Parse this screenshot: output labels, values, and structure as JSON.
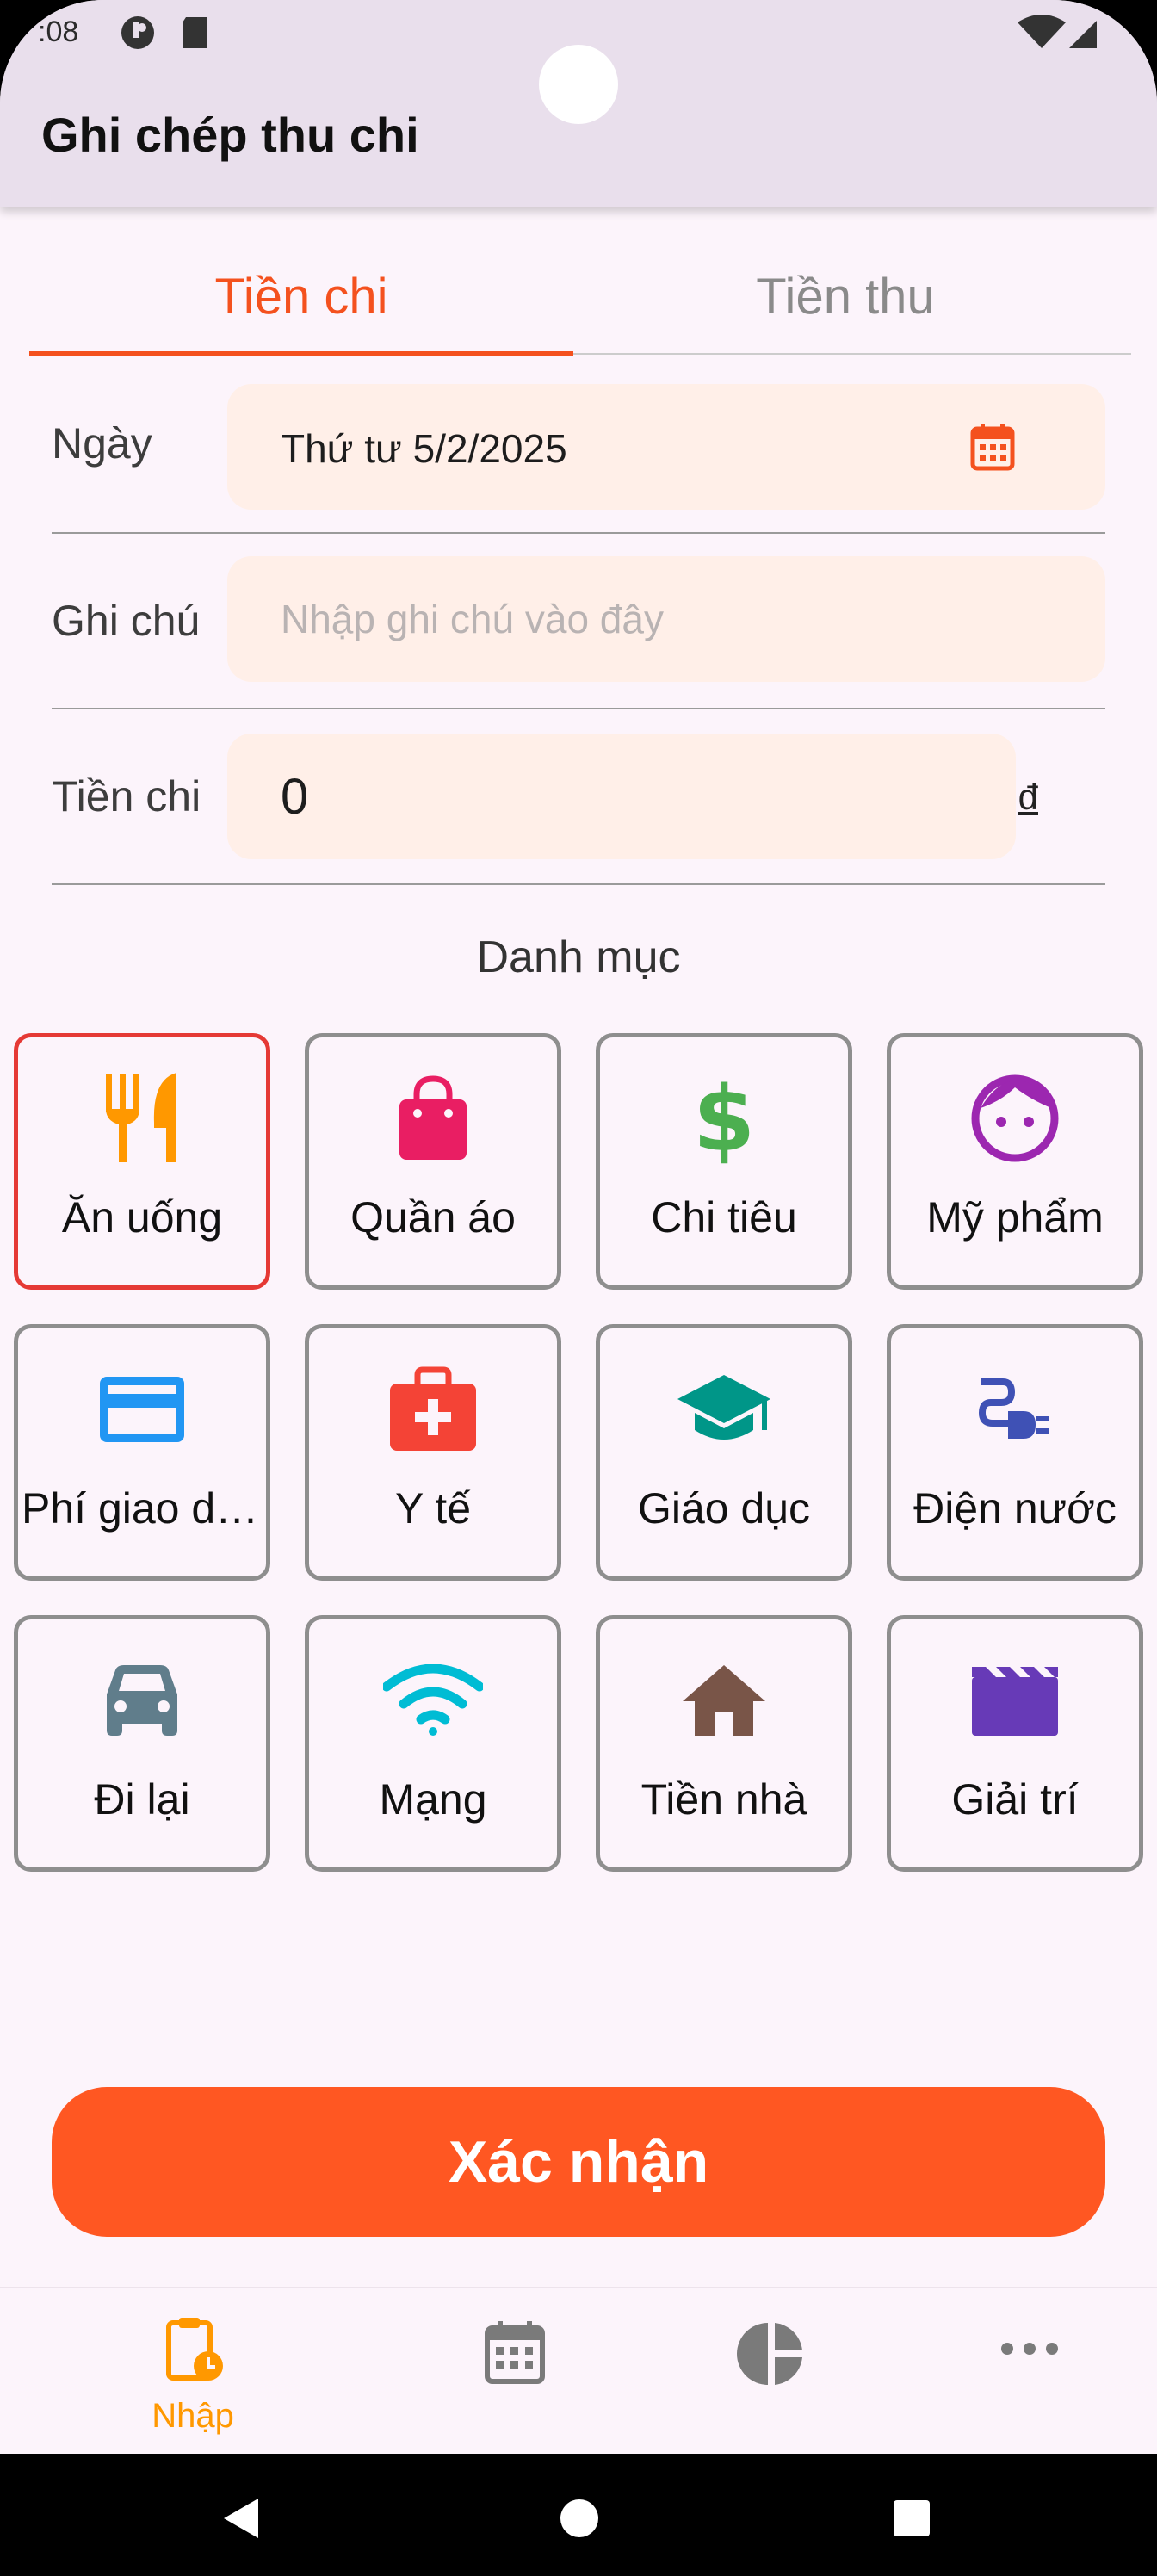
{
  "status_bar": {
    "time": ":08"
  },
  "app_bar": {
    "title": "Ghi chép thu chi"
  },
  "tabs": [
    {
      "label": "Tiền chi",
      "active": true
    },
    {
      "label": "Tiền thu",
      "active": false
    }
  ],
  "form": {
    "date": {
      "label": "Ngày",
      "value": "Thứ tư 5/2/2025"
    },
    "note": {
      "label": "Ghi chú",
      "placeholder": "Nhập ghi chú vào đây"
    },
    "amount": {
      "label": "Tiền chi",
      "value": "0",
      "currency": "đ"
    }
  },
  "categories_title": "Danh mục",
  "categories": [
    {
      "label": "Ăn uống",
      "icon": "restaurant-icon",
      "color": "#FF9800",
      "selected": true
    },
    {
      "label": "Quần áo",
      "icon": "shopping-bag-icon",
      "color": "#E91E63",
      "selected": false
    },
    {
      "label": "Chi tiêu",
      "icon": "dollar-icon",
      "color": "#4CAF50",
      "selected": false
    },
    {
      "label": "Mỹ phẩm",
      "icon": "face-icon",
      "color": "#9C27B0",
      "selected": false
    },
    {
      "label": "Phí giao dịch",
      "icon": "credit-card-icon",
      "color": "#2196F3",
      "selected": false
    },
    {
      "label": "Y tế",
      "icon": "medical-kit-icon",
      "color": "#F44336",
      "selected": false
    },
    {
      "label": "Giáo dục",
      "icon": "graduation-cap-icon",
      "color": "#009688",
      "selected": false
    },
    {
      "label": "Điện nước",
      "icon": "power-plug-icon",
      "color": "#3F51B5",
      "selected": false
    },
    {
      "label": "Đi lại",
      "icon": "car-icon",
      "color": "#607D8B",
      "selected": false
    },
    {
      "label": "Mạng",
      "icon": "wifi-icon",
      "color": "#00BCD4",
      "selected": false
    },
    {
      "label": "Tiền nhà",
      "icon": "home-icon",
      "color": "#795548",
      "selected": false
    },
    {
      "label": "Giải trí",
      "icon": "clapperboard-icon",
      "color": "#673AB7",
      "selected": false
    }
  ],
  "confirm_button": "Xác nhận",
  "bottom_nav": [
    {
      "label": "Nhập",
      "icon": "clipboard-clock-icon",
      "active": true
    },
    {
      "label": "",
      "icon": "calendar-icon",
      "active": false
    },
    {
      "label": "",
      "icon": "pie-chart-icon",
      "active": false
    },
    {
      "label": "",
      "icon": "more-icon",
      "active": false
    }
  ],
  "colors": {
    "accent": "#F4511E",
    "confirm": "#FF5722",
    "field_bg": "#FFEFE8",
    "nav_active": "#FF9800",
    "nav_inactive": "#7A7A7A"
  }
}
